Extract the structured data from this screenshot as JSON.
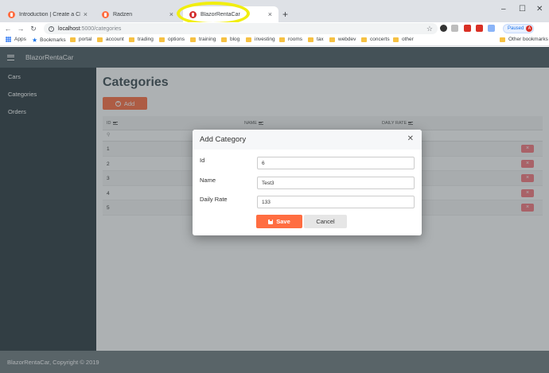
{
  "browser": {
    "tabs": [
      {
        "title": "Introduction | Create a CRM app",
        "favicon_color": "#ff6d41",
        "active": false
      },
      {
        "title": "Radzen",
        "favicon_color": "#ff6d41",
        "active": false
      },
      {
        "title": "BlazorRentaCar",
        "favicon_color": "#d32f2f",
        "active": true
      }
    ],
    "url_host": "localhost",
    "url_path": ":5000/categories",
    "profile_status": "Paused",
    "profile_initial": "A",
    "bookmarks": [
      "Apps",
      "Bookmarks",
      "portal",
      "account",
      "trading",
      "options",
      "training",
      "blog",
      "investing",
      "rooms",
      "tax",
      "webdev",
      "concerts",
      "other"
    ],
    "other_bookmarks": "Other bookmarks"
  },
  "app": {
    "brand": "BlazorRentaCar",
    "nav": [
      "Cars",
      "Categories",
      "Orders"
    ],
    "footer": "BlazorRentaCar, Copyright © 2019"
  },
  "page": {
    "title": "Categories",
    "add_label": "Add",
    "columns": [
      "ID",
      "NAME",
      "DAILY RATE"
    ],
    "rows": [
      "1",
      "2",
      "3",
      "4",
      "5"
    ],
    "delete_glyph": "×"
  },
  "dialog": {
    "title": "Add Category",
    "fields": [
      {
        "label": "Id",
        "value": "6"
      },
      {
        "label": "Name",
        "value": "Test3"
      },
      {
        "label": "Daily Rate",
        "value": "133"
      }
    ],
    "save_label": "Save",
    "cancel_label": "Cancel"
  },
  "colors": {
    "accent": "#ff6d41",
    "header": "#4a5a61",
    "sidebar": "#2b3a40",
    "danger": "#f9777f",
    "highlight": "#f1ee0f"
  }
}
